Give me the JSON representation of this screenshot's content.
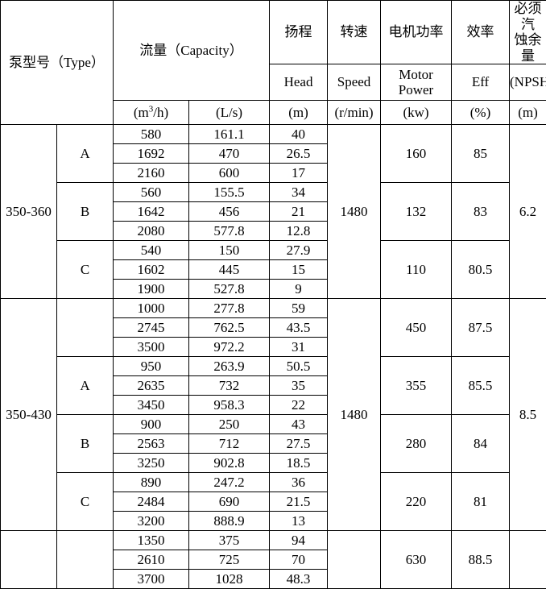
{
  "header": {
    "type_label": "泵型号（Type）",
    "capacity_label": "流量（Capacity）",
    "capacity_unit_m3h": "/h)",
    "capacity_unit_m3h_prefix": "(m",
    "capacity_unit_m3h_sup": "3",
    "capacity_unit_ls": "(L/s)",
    "head_cn": "扬程",
    "head_en": "Head",
    "head_unit": "(m)",
    "speed_cn": "转速",
    "speed_en": "Speed",
    "speed_unit": "(r/min)",
    "power_cn": "电机功率",
    "power_en_line1": "Motor",
    "power_en_line2": "Power",
    "power_unit": "(kw)",
    "eff_cn": "效率",
    "eff_en": "Eff",
    "eff_unit": "(%)",
    "npsh_cn_line1": "必须汽",
    "npsh_cn_line2": "蚀余量",
    "npsh_en": "(NPSH)r",
    "npsh_unit": "(m)"
  },
  "blocks": [
    {
      "type": "350-360",
      "speed": "1480",
      "npsh": "6.2",
      "groups": [
        {
          "letter": "A",
          "power": "160",
          "eff": "85",
          "rows": [
            {
              "q_m3h": "580",
              "q_ls": "161.1",
              "head": "40"
            },
            {
              "q_m3h": "1692",
              "q_ls": "470",
              "head": "26.5"
            },
            {
              "q_m3h": "2160",
              "q_ls": "600",
              "head": "17"
            }
          ]
        },
        {
          "letter": "B",
          "power": "132",
          "eff": "83",
          "rows": [
            {
              "q_m3h": "560",
              "q_ls": "155.5",
              "head": "34"
            },
            {
              "q_m3h": "1642",
              "q_ls": "456",
              "head": "21"
            },
            {
              "q_m3h": "2080",
              "q_ls": "577.8",
              "head": "12.8"
            }
          ]
        },
        {
          "letter": "C",
          "power": "110",
          "eff": "80.5",
          "rows": [
            {
              "q_m3h": "540",
              "q_ls": "150",
              "head": "27.9"
            },
            {
              "q_m3h": "1602",
              "q_ls": "445",
              "head": "15"
            },
            {
              "q_m3h": "1900",
              "q_ls": "527.8",
              "head": "9"
            }
          ]
        }
      ]
    },
    {
      "type": "350-430",
      "speed": "1480",
      "npsh": "8.5",
      "groups": [
        {
          "letter": "",
          "power": "450",
          "eff": "87.5",
          "rows": [
            {
              "q_m3h": "1000",
              "q_ls": "277.8",
              "head": "59"
            },
            {
              "q_m3h": "2745",
              "q_ls": "762.5",
              "head": "43.5"
            },
            {
              "q_m3h": "3500",
              "q_ls": "972.2",
              "head": "31"
            }
          ]
        },
        {
          "letter": "A",
          "power": "355",
          "eff": "85.5",
          "rows": [
            {
              "q_m3h": "950",
              "q_ls": "263.9",
              "head": "50.5"
            },
            {
              "q_m3h": "2635",
              "q_ls": "732",
              "head": "35"
            },
            {
              "q_m3h": "3450",
              "q_ls": "958.3",
              "head": "22"
            }
          ]
        },
        {
          "letter": "B",
          "power": "280",
          "eff": "84",
          "rows": [
            {
              "q_m3h": "900",
              "q_ls": "250",
              "head": "43"
            },
            {
              "q_m3h": "2563",
              "q_ls": "712",
              "head": "27.5"
            },
            {
              "q_m3h": "3250",
              "q_ls": "902.8",
              "head": "18.5"
            }
          ]
        },
        {
          "letter": "C",
          "power": "220",
          "eff": "81",
          "rows": [
            {
              "q_m3h": "890",
              "q_ls": "247.2",
              "head": "36"
            },
            {
              "q_m3h": "2484",
              "q_ls": "690",
              "head": "21.5"
            },
            {
              "q_m3h": "3200",
              "q_ls": "888.9",
              "head": "13"
            }
          ]
        }
      ]
    },
    {
      "type": "",
      "speed": "",
      "npsh": "",
      "groups": [
        {
          "letter": "",
          "power": "630",
          "eff": "88.5",
          "rows": [
            {
              "q_m3h": "1350",
              "q_ls": "375",
              "head": "94"
            },
            {
              "q_m3h": "2610",
              "q_ls": "725",
              "head": "70"
            },
            {
              "q_m3h": "3700",
              "q_ls": "1028",
              "head": "48.3"
            }
          ]
        }
      ]
    }
  ]
}
